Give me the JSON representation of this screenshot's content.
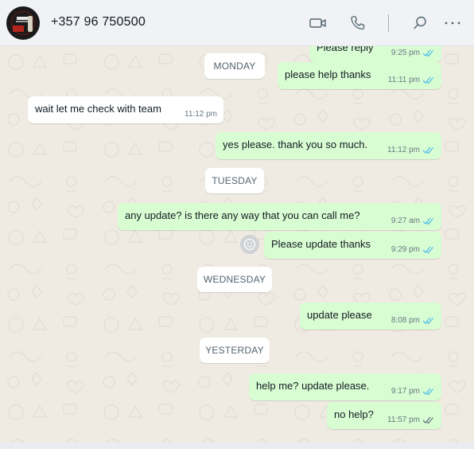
{
  "header": {
    "contact_name": "+357 96 750500",
    "icons": [
      "video-call-icon",
      "voice-call-icon",
      "search-icon",
      "menu-icon"
    ]
  },
  "colors": {
    "outgoing_bubble": "#d9fdd3",
    "incoming_bubble": "#ffffff",
    "read_tick": "#53bdeb",
    "sent_tick": "#667781",
    "chat_background": "#efeae2"
  },
  "messages": [
    {
      "type": "out",
      "text": "Please reply",
      "time": "9:25 pm",
      "status": "read"
    },
    {
      "type": "day",
      "text": "MONDAY"
    },
    {
      "type": "out",
      "text": "please help thanks",
      "time": "11:11 pm",
      "status": "read"
    },
    {
      "type": "in",
      "text": "wait let me check with team",
      "time": "11:12 pm"
    },
    {
      "type": "out",
      "text": "yes please. thank you so much.",
      "time": "11:12 pm",
      "status": "read"
    },
    {
      "type": "day",
      "text": "TUESDAY"
    },
    {
      "type": "out",
      "text": "any update? is there any way that you can call me?",
      "time": "9:27 am",
      "status": "read"
    },
    {
      "type": "out",
      "text": "Please update thanks",
      "time": "9:29 pm",
      "status": "read"
    },
    {
      "type": "day",
      "text": "WEDNESDAY"
    },
    {
      "type": "out",
      "text": "update please",
      "time": "8:08 pm",
      "status": "read"
    },
    {
      "type": "day",
      "text": "YESTERDAY"
    },
    {
      "type": "out",
      "text": "help me? update please.",
      "time": "9:17 pm",
      "status": "read"
    },
    {
      "type": "out",
      "text": "no help?",
      "time": "11:57 pm",
      "status": "delivered"
    }
  ]
}
